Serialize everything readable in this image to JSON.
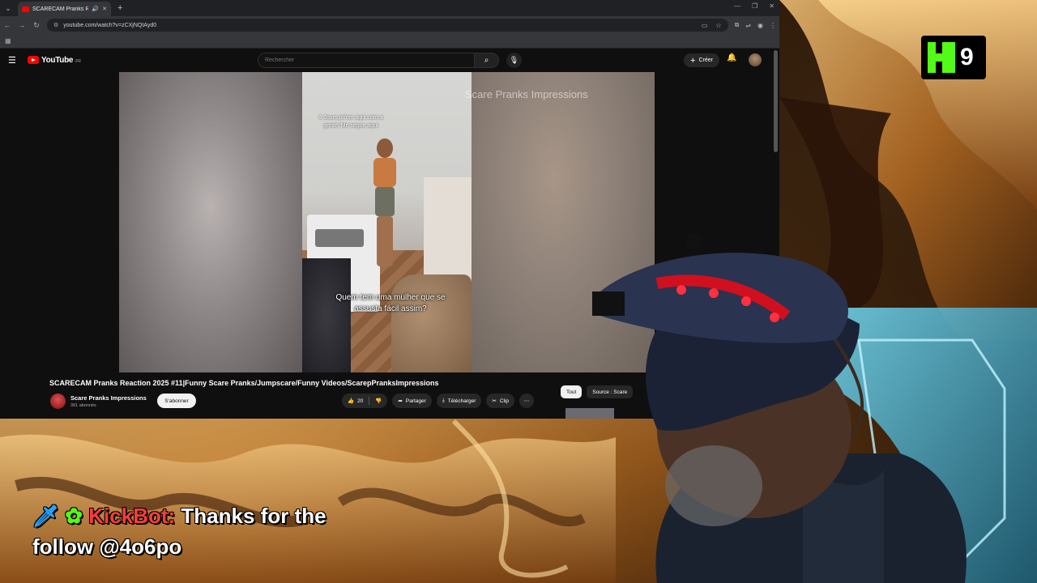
{
  "browser": {
    "tab_title": "SCARECAM Pranks Reaction",
    "url": "youtube.com/watch?v=zCXjNQtAyd0",
    "colors": {
      "tab_bg": "#35363a",
      "frame_bg": "#202124"
    }
  },
  "youtube": {
    "logo_text": "YouTube",
    "country_code": "FR",
    "search_placeholder": "Rechercher",
    "create_label": "Créer",
    "video": {
      "top_caption": "4 Jours pr/ver aqui com a gente! Me segue aqui",
      "subtitle": "Quem tem uma mulher que se assusta fácil assim?",
      "watermark": "Scare Pranks Impressions"
    },
    "title": "SCARECAM Pranks Reaction 2025 #11|Funny Scare Pranks/Jumpscare/Funny Videos/ScarepPranksImpressions",
    "channel": {
      "name": "Scare Pranks Impressions",
      "subscribers": "391 abonnés"
    },
    "subscribe_label": "S'abonner",
    "actions": {
      "likes": "20",
      "share": "Partager",
      "download": "Télécharger",
      "clip": "Clip"
    },
    "chips": [
      "Tout",
      "Source : Scare"
    ],
    "brand_color": "#ff0000"
  },
  "overlay": {
    "k9_number": "9",
    "chat": {
      "bot_name": "KickBot:",
      "message_line1": "Thanks for the",
      "message_line2": "follow @4o6po"
    },
    "kick_green": "#53fc18"
  }
}
